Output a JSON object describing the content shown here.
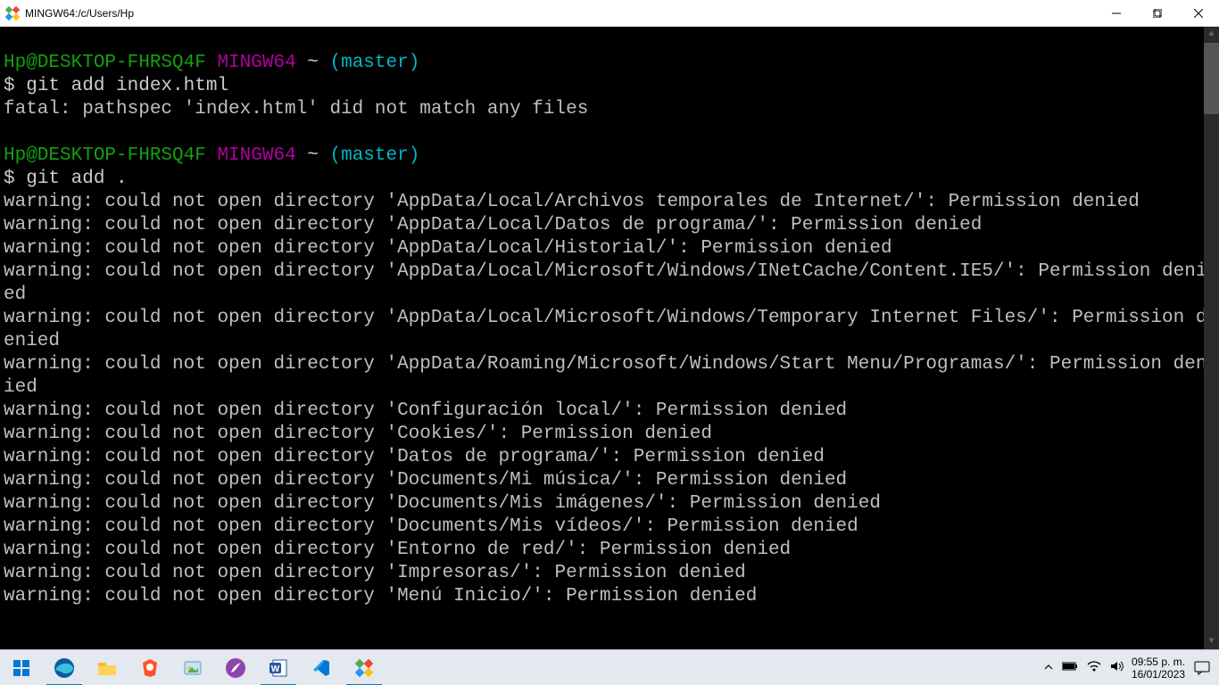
{
  "titlebar": {
    "title": "MINGW64:/c/Users/Hp"
  },
  "terminal": {
    "prompt1": {
      "userhost": "Hp@DESKTOP-FHRSQ4F",
      "shell": "MINGW64",
      "path": "~",
      "branch": "(master)",
      "symbol": "$",
      "command": "git add index.html"
    },
    "output1": "fatal: pathspec 'index.html' did not match any files",
    "prompt2": {
      "userhost": "Hp@DESKTOP-FHRSQ4F",
      "shell": "MINGW64",
      "path": "~",
      "branch": "(master)",
      "symbol": "$",
      "command": "git add ."
    },
    "warnings": [
      "warning: could not open directory 'AppData/Local/Archivos temporales de Internet/': Permission denied",
      "warning: could not open directory 'AppData/Local/Datos de programa/': Permission denied",
      "warning: could not open directory 'AppData/Local/Historial/': Permission denied",
      "warning: could not open directory 'AppData/Local/Microsoft/Windows/INetCache/Content.IE5/': Permission denied",
      "warning: could not open directory 'AppData/Local/Microsoft/Windows/Temporary Internet Files/': Permission denied",
      "warning: could not open directory 'AppData/Roaming/Microsoft/Windows/Start Menu/Programas/': Permission denied",
      "warning: could not open directory 'Configuración local/': Permission denied",
      "warning: could not open directory 'Cookies/': Permission denied",
      "warning: could not open directory 'Datos de programa/': Permission denied",
      "warning: could not open directory 'Documents/Mi música/': Permission denied",
      "warning: could not open directory 'Documents/Mis imágenes/': Permission denied",
      "warning: could not open directory 'Documents/Mis vídeos/': Permission denied",
      "warning: could not open directory 'Entorno de red/': Permission denied",
      "warning: could not open directory 'Impresoras/': Permission denied",
      "warning: could not open directory 'Menú Inicio/': Permission denied"
    ]
  },
  "taskbar": {
    "time": "09:55 p. m.",
    "date": "16/01/2023"
  }
}
